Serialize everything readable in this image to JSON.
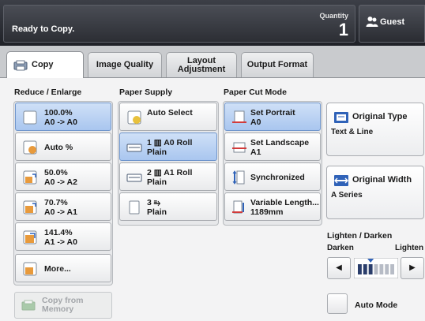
{
  "status": {
    "message": "Ready to Copy.",
    "quantity_label": "Quantity",
    "quantity_value": "1"
  },
  "user": {
    "label": "Guest",
    "icon": "user-icon"
  },
  "tabs": [
    {
      "label": "Copy",
      "active": true
    },
    {
      "label": "Image Quality",
      "active": false
    },
    {
      "label": "Layout Adjustment",
      "active": false
    },
    {
      "label": "Output Format",
      "active": false
    }
  ],
  "reduce_enlarge": {
    "title": "Reduce / Enlarge",
    "options": [
      {
        "line1": "100.0%",
        "line2": "A0 -> A0",
        "selected": true
      },
      {
        "line1": "Auto %",
        "line2": "",
        "selected": false
      },
      {
        "line1": "50.0%",
        "line2": "A0 -> A2",
        "selected": false
      },
      {
        "line1": "70.7%",
        "line2": "A0 -> A1",
        "selected": false
      },
      {
        "line1": "141.4%",
        "line2": "A1 -> A0",
        "selected": false
      },
      {
        "line1": "More...",
        "line2": "",
        "selected": false
      }
    ]
  },
  "paper_supply": {
    "title": "Paper Supply",
    "options": [
      {
        "line1": "Auto Select",
        "line2": "",
        "selected": false
      },
      {
        "line1": "1 ▥ A0 Roll",
        "line2": "Plain",
        "selected": true
      },
      {
        "line1": "2 ▥ A1 Roll",
        "line2": "Plain",
        "selected": false
      },
      {
        "line1": "3 ⥱",
        "line2": "Plain",
        "selected": false
      }
    ]
  },
  "paper_cut": {
    "title": "Paper Cut Mode",
    "options": [
      {
        "line1": "Set Portrait",
        "line2": "A0",
        "selected": true
      },
      {
        "line1": "Set Landscape",
        "line2": "A1",
        "selected": false
      },
      {
        "line1": "Synchronized",
        "line2": "",
        "selected": false
      },
      {
        "line1": "Variable Length...",
        "line2": "1189mm",
        "selected": false
      }
    ]
  },
  "original_type": {
    "title": "Original Type",
    "value": "Text & Line"
  },
  "original_width": {
    "title": "Original Width",
    "value": "A Series"
  },
  "lighten_darken": {
    "title": "Lighten / Darken",
    "dark_label": "Darken",
    "light_label": "Lighten",
    "left_arrow": "◀",
    "right_arrow": "▶",
    "level": 3,
    "levels": 7
  },
  "auto_mode": {
    "label": "Auto Mode"
  },
  "copy_from_memory": {
    "line1": "Copy from",
    "line2": "Memory",
    "enabled": false
  },
  "colors": {
    "selected": "#a9c6ef",
    "topbar": "#2c2e34",
    "accent_blue": "#2f62b8",
    "icon_orange": "#e89a3c"
  }
}
